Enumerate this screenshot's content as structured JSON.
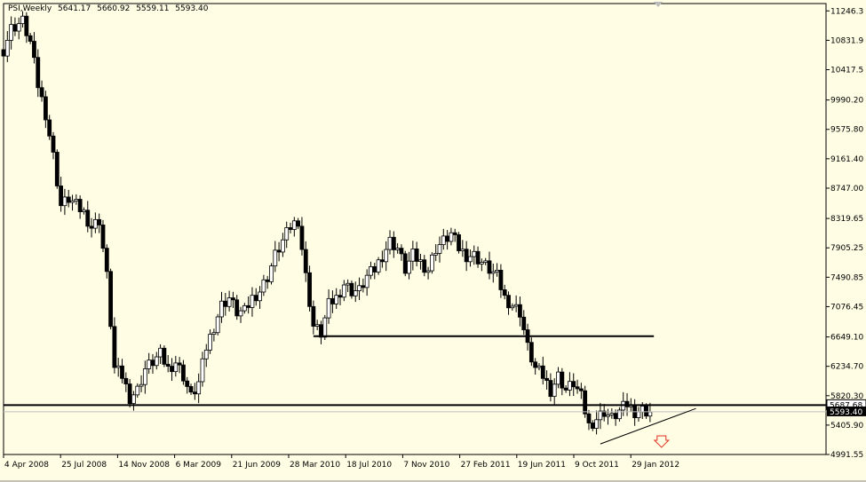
{
  "header": {
    "symbol": "PSI,Weekly",
    "open": "5641.17",
    "high": "5660.92",
    "low": "5559.11",
    "close": "5593.40"
  },
  "current_price_tags": {
    "level_line": "5687.68",
    "bid": "5593.40"
  },
  "chart_data": {
    "type": "candlestick",
    "symbol": "PSI",
    "timeframe": "Weekly",
    "y_ticks": [
      "11246.3",
      "10831.9",
      "10417.5",
      "9990.20",
      "9575.80",
      "9161.40",
      "8747.00",
      "8319.65",
      "7905.25",
      "7490.85",
      "7076.45",
      "6649.10",
      "6234.70",
      "5820.30",
      "5405.90",
      "4991.55"
    ],
    "x_ticks": [
      "4 Apr 2008",
      "25 Jul 2008",
      "14 Nov 2008",
      "6 Mar 2009",
      "21 Jun 2009",
      "28 Mar 2010",
      "18 Jul 2010",
      "7 Nov 2010",
      "27 Feb 2011",
      "19 Jun 2011",
      "9 Oct 2011",
      "29 Jan 2012"
    ],
    "ylim": [
      4991.55,
      11350
    ],
    "xlim": [
      0,
      215
    ],
    "close_path": [
      [
        0,
        10700
      ],
      [
        2,
        11000
      ],
      [
        5,
        11100
      ],
      [
        7,
        10800
      ],
      [
        9,
        10200
      ],
      [
        11,
        9800
      ],
      [
        13,
        9200
      ],
      [
        15,
        8500
      ],
      [
        17,
        8600
      ],
      [
        19,
        8500
      ],
      [
        21,
        8400
      ],
      [
        23,
        8200
      ],
      [
        25,
        8300
      ],
      [
        27,
        7500
      ],
      [
        29,
        6200
      ],
      [
        31,
        6100
      ],
      [
        33,
        5800
      ],
      [
        35,
        5900
      ],
      [
        37,
        6200
      ],
      [
        39,
        6300
      ],
      [
        41,
        6400
      ],
      [
        43,
        6200
      ],
      [
        45,
        6300
      ],
      [
        47,
        6100
      ],
      [
        49,
        5800
      ],
      [
        51,
        6000
      ],
      [
        53,
        6500
      ],
      [
        55,
        6800
      ],
      [
        57,
        7100
      ],
      [
        59,
        7200
      ],
      [
        61,
        7000
      ],
      [
        63,
        7000
      ],
      [
        65,
        7200
      ],
      [
        67,
        7300
      ],
      [
        69,
        7500
      ],
      [
        71,
        7800
      ],
      [
        73,
        8000
      ],
      [
        75,
        8200
      ],
      [
        77,
        8300
      ],
      [
        79,
        7500
      ],
      [
        81,
        6800
      ],
      [
        83,
        6700
      ],
      [
        85,
        7100
      ],
      [
        87,
        7200
      ],
      [
        89,
        7400
      ],
      [
        91,
        7300
      ],
      [
        93,
        7300
      ],
      [
        95,
        7500
      ],
      [
        97,
        7600
      ],
      [
        99,
        7800
      ],
      [
        101,
        8000
      ],
      [
        103,
        7900
      ],
      [
        105,
        7600
      ],
      [
        107,
        7800
      ],
      [
        109,
        7700
      ],
      [
        111,
        7600
      ],
      [
        113,
        7900
      ],
      [
        115,
        8000
      ],
      [
        117,
        8100
      ],
      [
        119,
        7900
      ],
      [
        121,
        7800
      ],
      [
        123,
        7800
      ],
      [
        125,
        7700
      ],
      [
        127,
        7600
      ],
      [
        129,
        7500
      ],
      [
        131,
        7200
      ],
      [
        133,
        7100
      ],
      [
        135,
        7000
      ],
      [
        137,
        6500
      ],
      [
        139,
        6200
      ],
      [
        141,
        6100
      ],
      [
        143,
        5900
      ],
      [
        145,
        6100
      ],
      [
        147,
        5900
      ],
      [
        149,
        6000
      ],
      [
        151,
        5800
      ],
      [
        153,
        5400
      ],
      [
        155,
        5500
      ],
      [
        157,
        5600
      ],
      [
        159,
        5500
      ],
      [
        161,
        5600
      ],
      [
        163,
        5700
      ],
      [
        165,
        5600
      ],
      [
        167,
        5620
      ],
      [
        169,
        5590
      ]
    ],
    "horizontal_levels": [
      {
        "value": 6660,
        "x_start": 81,
        "x_end": 170
      },
      {
        "value": 5687.68,
        "x_start": 0,
        "x_end": 215
      }
    ],
    "trendline": {
      "x0": 156,
      "y0": 5140,
      "x1": 181,
      "y1": 5640
    },
    "arrow_down": {
      "x": 172,
      "value": 5180
    },
    "colors": {
      "background": "#fffde4",
      "bull": "#ffffff",
      "bear": "#000000",
      "grid": "#000000",
      "current_line": "#c0c0c0"
    },
    "grid": false
  }
}
